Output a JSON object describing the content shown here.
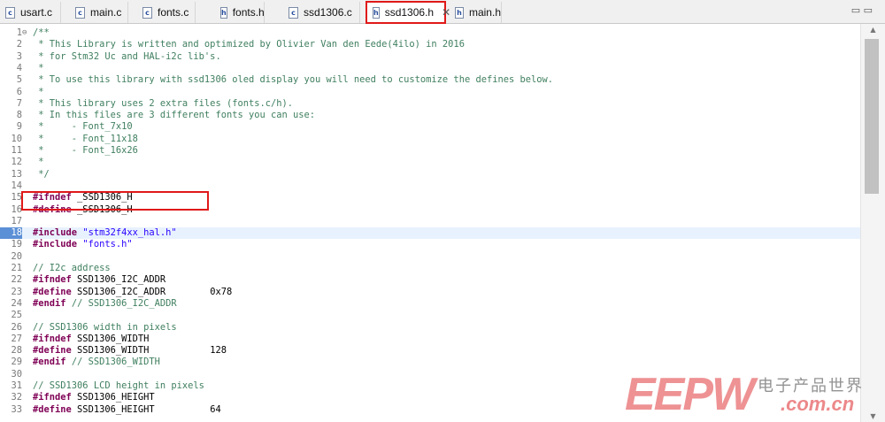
{
  "tabs": [
    {
      "label": "usart.c",
      "icon": "c-file-icon",
      "glyph": "c"
    },
    {
      "label": "main.c",
      "icon": "c-file-icon",
      "glyph": "c"
    },
    {
      "label": "fonts.c",
      "icon": "c-file-icon",
      "glyph": "c"
    },
    {
      "label": "fonts.h",
      "icon": "h-file-icon",
      "glyph": "h"
    },
    {
      "label": "ssd1306.c",
      "icon": "c-file-icon",
      "glyph": "c"
    },
    {
      "label": "ssd1306.h",
      "icon": "h-file-icon",
      "glyph": "h",
      "active": true
    },
    {
      "label": "main.h",
      "icon": "h-file-icon",
      "glyph": "h"
    }
  ],
  "tab_close_glyph": "✕",
  "tab_overflow_glyph": "▭ ▭",
  "code": {
    "current_line": 18,
    "lines": [
      {
        "n": "1",
        "t": "/**"
      },
      {
        "n": "2",
        "t": " * This Library is written and optimized by Olivier Van den Eede(4ilo) in 2016"
      },
      {
        "n": "3",
        "t": " * for Stm32 Uc and HAL-i2c lib's."
      },
      {
        "n": "4",
        "t": " *"
      },
      {
        "n": "5",
        "t": " * To use this library with ssd1306 oled display you will need to customize the defines below."
      },
      {
        "n": "6",
        "t": " *"
      },
      {
        "n": "7",
        "t": " * This library uses 2 extra files (fonts.c/h)."
      },
      {
        "n": "8",
        "t": " * In this files are 3 different fonts you can use:"
      },
      {
        "n": "9",
        "t": " *     - Font_7x10"
      },
      {
        "n": "10",
        "t": " *     - Font_11x18"
      },
      {
        "n": "11",
        "t": " *     - Font_16x26"
      },
      {
        "n": "12",
        "t": " *"
      },
      {
        "n": "13",
        "t": " */"
      },
      {
        "n": "14",
        "t": ""
      },
      {
        "n": "15",
        "t": "#ifndef _SSD1306_H"
      },
      {
        "n": "16",
        "t": "#define _SSD1306_H"
      },
      {
        "n": "17",
        "t": ""
      },
      {
        "n": "18",
        "t": "#include \"stm32f4xx_hal.h\""
      },
      {
        "n": "19",
        "t": "#include \"fonts.h\""
      },
      {
        "n": "20",
        "t": ""
      },
      {
        "n": "21",
        "t": "// I2c address"
      },
      {
        "n": "22",
        "t": "#ifndef SSD1306_I2C_ADDR"
      },
      {
        "n": "23",
        "t": "#define SSD1306_I2C_ADDR        0x78"
      },
      {
        "n": "24",
        "t": "#endif // SSD1306_I2C_ADDR"
      },
      {
        "n": "25",
        "t": ""
      },
      {
        "n": "26",
        "t": "// SSD1306 width in pixels"
      },
      {
        "n": "27",
        "t": "#ifndef SSD1306_WIDTH"
      },
      {
        "n": "28",
        "t": "#define SSD1306_WIDTH           128"
      },
      {
        "n": "29",
        "t": "#endif // SSD1306_WIDTH"
      },
      {
        "n": "30",
        "t": ""
      },
      {
        "n": "31",
        "t": "// SSD1306 LCD height in pixels"
      },
      {
        "n": "32",
        "t": "#ifndef SSD1306_HEIGHT"
      },
      {
        "n": "33",
        "t": "#define SSD1306_HEIGHT          64"
      }
    ]
  },
  "watermark": {
    "brand": "EEPW",
    "chinese": "电子产品世界",
    "domain": ".com.cn"
  },
  "colors": {
    "comment": "#3f7f5f",
    "keyword": "#7f0055",
    "string": "#2a00ff",
    "highlight": "#e01919",
    "current_line": "#e8f2fe"
  }
}
